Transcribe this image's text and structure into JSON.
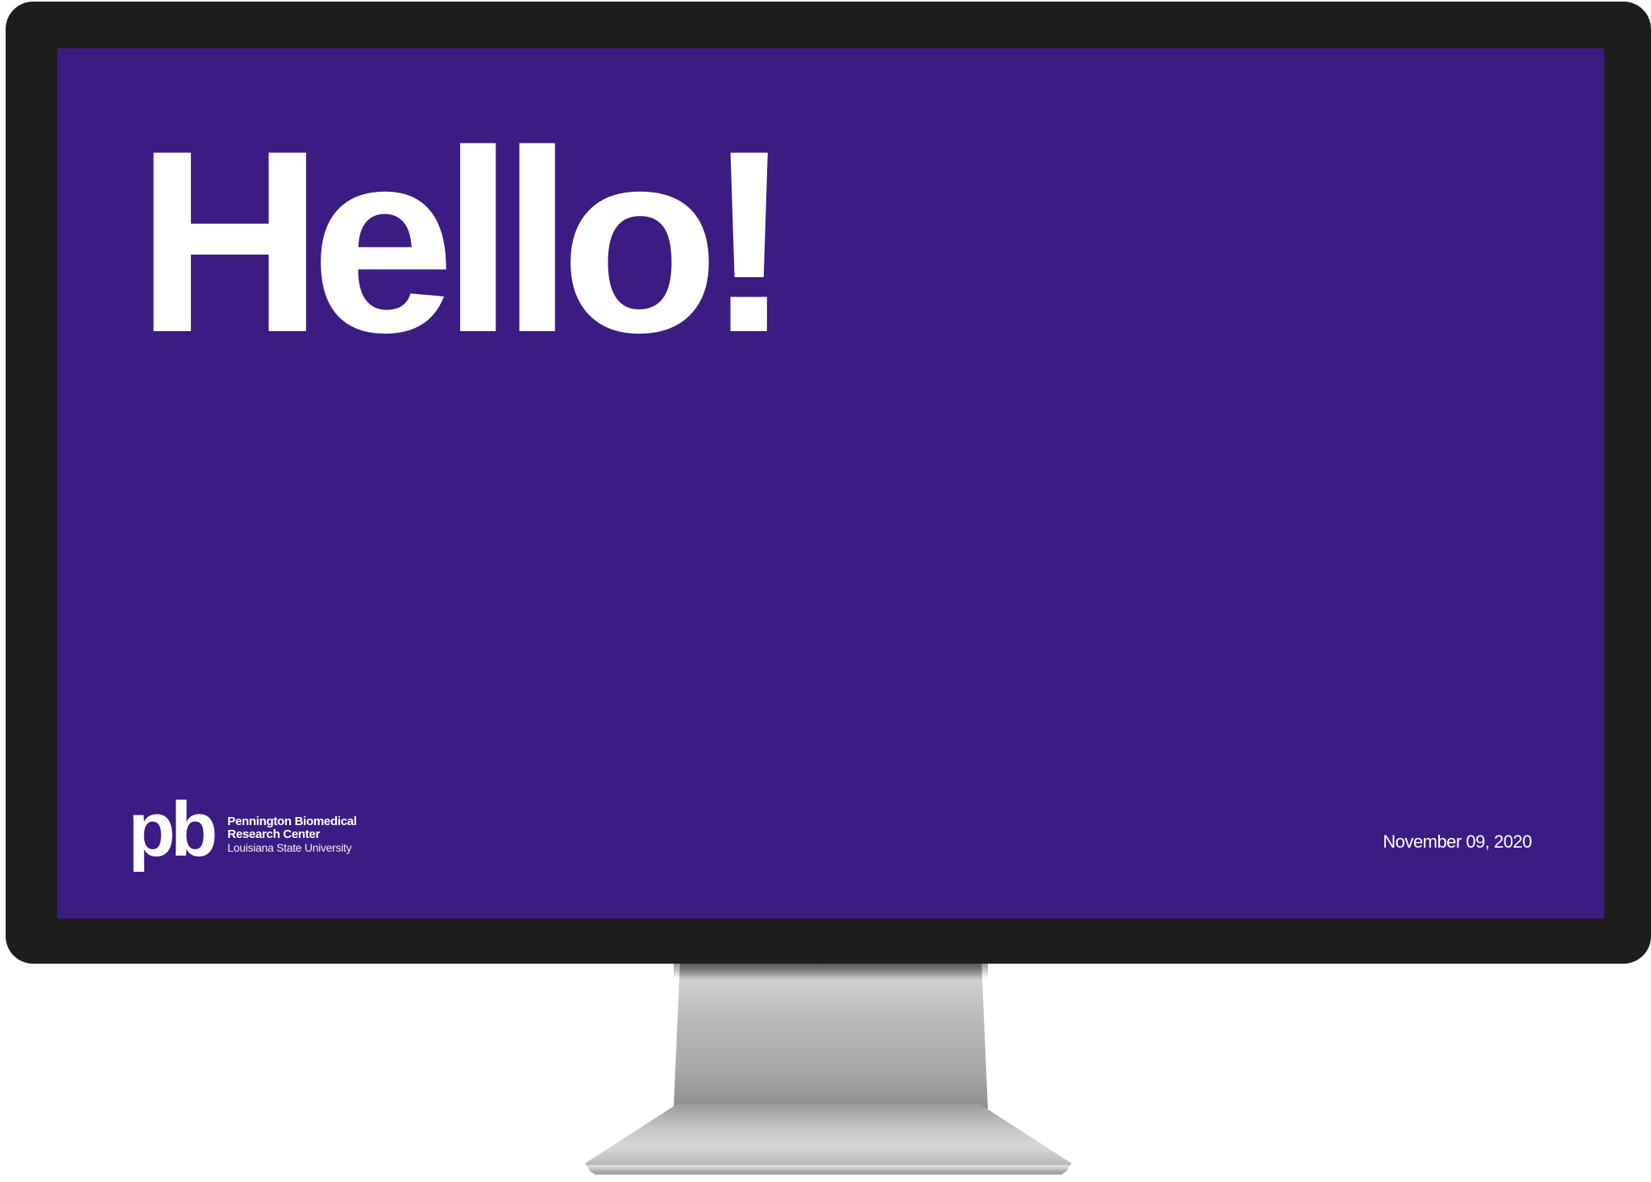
{
  "screen": {
    "headline": "Hello!",
    "logo": {
      "mark": "pb",
      "line1": "Pennington Biomedical",
      "line2": "Research Center",
      "line3": "Louisiana State University"
    },
    "date": "November 09, 2020"
  },
  "colors": {
    "screen_background": "#3c1c82",
    "bezel": "#1d1d1b",
    "text": "#ffffff",
    "page_background": "#ffffff"
  }
}
